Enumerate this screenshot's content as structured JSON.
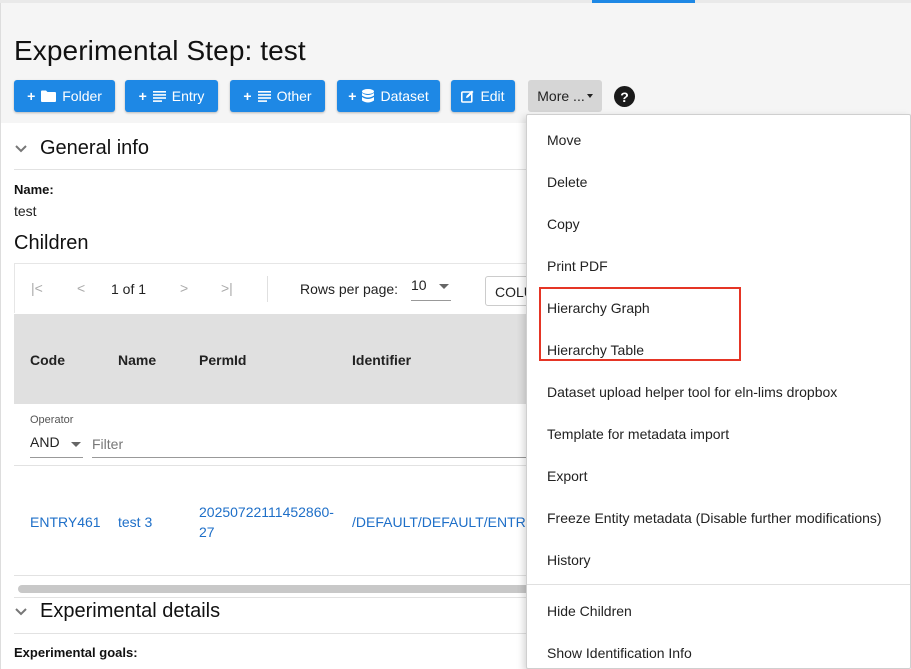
{
  "page": {
    "title": "Experimental Step: test"
  },
  "toolbar": {
    "folder_label": "Folder",
    "entry_label": "Entry",
    "other_label": "Other",
    "dataset_label": "Dataset",
    "edit_label": "Edit",
    "more_label": "More ...",
    "help_glyph": "?"
  },
  "general_info": {
    "title": "General info",
    "name_label": "Name:",
    "name_value": "test"
  },
  "children": {
    "title": "Children",
    "pager": {
      "page_text": "1 of 1",
      "rows_per_page_label": "Rows per page:",
      "rows_per_page_value": "10",
      "columns_button": "COLU"
    },
    "columns": [
      "Code",
      "Name",
      "PermId",
      "Identifier"
    ],
    "filter": {
      "operator_label": "Operator",
      "operator_value": "AND",
      "filter_placeholder": "Filter"
    },
    "rows": [
      {
        "code": "ENTRY461",
        "name": "test 3",
        "permid_line1": "20250722111452860-",
        "permid_line2": "27",
        "identifier": "/DEFAULT/DEFAULT/ENTR"
      }
    ]
  },
  "experimental_details": {
    "title": "Experimental details",
    "goals_label": "Experimental goals:"
  },
  "more_menu": {
    "items": [
      "Move",
      "Delete",
      "Copy",
      "Print PDF",
      "Hierarchy Graph",
      "Hierarchy Table",
      "Dataset upload helper tool for eln-lims dropbox",
      "Template for metadata import",
      "Export",
      "Freeze Entity metadata (Disable further modifications)",
      "History",
      "Hide Children",
      "Show Identification Info"
    ]
  },
  "colors": {
    "primary": "#1e88e5",
    "link": "#1e6fc8",
    "highlight": "#e53525",
    "header_bg": "#f5f5f5",
    "table_head_bg": "#e0e0e0"
  },
  "icons": {
    "folder": "folder-icon",
    "entry": "list-lines-icon",
    "other": "list-lines-icon",
    "dataset": "database-icon",
    "edit": "edit-icon",
    "help": "help-circle-icon",
    "collapse": "chevron-down-icon"
  }
}
